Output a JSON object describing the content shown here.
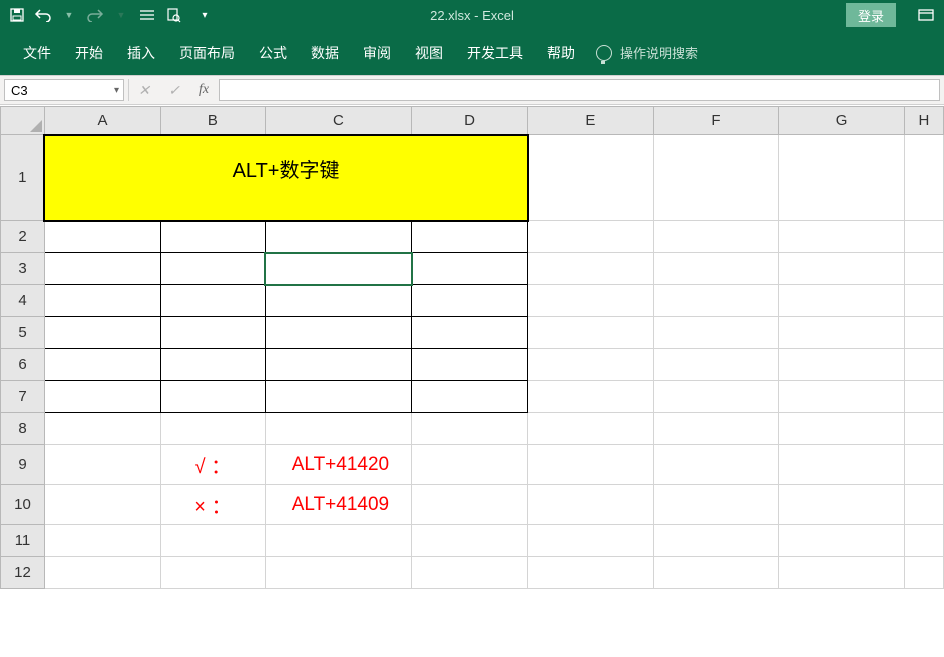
{
  "titlebar": {
    "filename": "22.xlsx - Excel",
    "login": "登录"
  },
  "tabs": {
    "file": "文件",
    "home": "开始",
    "insert": "插入",
    "layout": "页面布局",
    "formula": "公式",
    "data": "数据",
    "review": "审阅",
    "view": "视图",
    "dev": "开发工具",
    "help": "帮助",
    "tellme": "操作说明搜索"
  },
  "formula_bar": {
    "name_box": "C3",
    "value": ""
  },
  "columns": [
    "A",
    "B",
    "C",
    "D",
    "E",
    "F",
    "G",
    "H"
  ],
  "rows": [
    "1",
    "2",
    "3",
    "4",
    "5",
    "6",
    "7",
    "8",
    "9",
    "10",
    "11",
    "12"
  ],
  "cells": {
    "A1_merged": "ALT+数字键",
    "B9": "√ ：",
    "C9": "ALT+41420",
    "B10": "× ：",
    "C10": "ALT+41409"
  }
}
